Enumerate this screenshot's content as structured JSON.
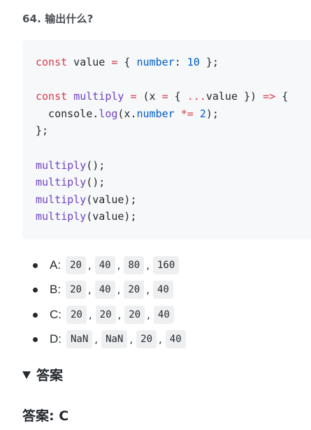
{
  "question": {
    "title": "64. 输出什么?"
  },
  "code": {
    "lines": [
      [
        {
          "t": "const",
          "c": "kw"
        },
        {
          "t": " value ",
          "c": "plain"
        },
        {
          "t": "=",
          "c": "op"
        },
        {
          "t": " { ",
          "c": "plain"
        },
        {
          "t": "number",
          "c": "prop"
        },
        {
          "t": ": ",
          "c": "plain"
        },
        {
          "t": "10",
          "c": "num"
        },
        {
          "t": " };",
          "c": "plain"
        }
      ],
      [],
      [
        {
          "t": "const",
          "c": "kw"
        },
        {
          "t": " ",
          "c": "plain"
        },
        {
          "t": "multiply",
          "c": "fn"
        },
        {
          "t": " ",
          "c": "plain"
        },
        {
          "t": "=",
          "c": "op"
        },
        {
          "t": " (x ",
          "c": "plain"
        },
        {
          "t": "=",
          "c": "op"
        },
        {
          "t": " { ",
          "c": "plain"
        },
        {
          "t": "...",
          "c": "op"
        },
        {
          "t": "value }) ",
          "c": "plain"
        },
        {
          "t": "=>",
          "c": "op"
        },
        {
          "t": " {",
          "c": "plain"
        }
      ],
      [
        {
          "t": "  console.",
          "c": "plain"
        },
        {
          "t": "log",
          "c": "fn"
        },
        {
          "t": "(x.",
          "c": "plain"
        },
        {
          "t": "number",
          "c": "prop"
        },
        {
          "t": " ",
          "c": "plain"
        },
        {
          "t": "*=",
          "c": "op"
        },
        {
          "t": " ",
          "c": "plain"
        },
        {
          "t": "2",
          "c": "num"
        },
        {
          "t": ");",
          "c": "plain"
        }
      ],
      [
        {
          "t": "};",
          "c": "plain"
        }
      ],
      [],
      [
        {
          "t": "multiply",
          "c": "fn"
        },
        {
          "t": "();",
          "c": "plain"
        }
      ],
      [
        {
          "t": "multiply",
          "c": "fn"
        },
        {
          "t": "();",
          "c": "plain"
        }
      ],
      [
        {
          "t": "multiply",
          "c": "fn"
        },
        {
          "t": "(value);",
          "c": "plain"
        }
      ],
      [
        {
          "t": "multiply",
          "c": "fn"
        },
        {
          "t": "(value);",
          "c": "plain"
        }
      ]
    ]
  },
  "options": [
    {
      "letter": "A:",
      "values": [
        "20",
        "40",
        "80",
        "160"
      ]
    },
    {
      "letter": "B:",
      "values": [
        "20",
        "40",
        "20",
        "40"
      ]
    },
    {
      "letter": "C:",
      "values": [
        "20",
        "20",
        "20",
        "40"
      ]
    },
    {
      "letter": "D:",
      "values": [
        "NaN",
        "NaN",
        "20",
        "40"
      ]
    }
  ],
  "separator": ",",
  "answer_toggle": {
    "label": "答案"
  },
  "answer": {
    "label": "答案:",
    "value": "C"
  },
  "colors": {
    "keyword": "#d73a49",
    "number": "#005cc5",
    "function": "#6f42c1",
    "code_background": "#f6f8fa",
    "chip_background": "#eeeff1"
  },
  "icons": {
    "answer_toggle": "triangle-down-icon",
    "option_bullet": "bullet-icon"
  }
}
